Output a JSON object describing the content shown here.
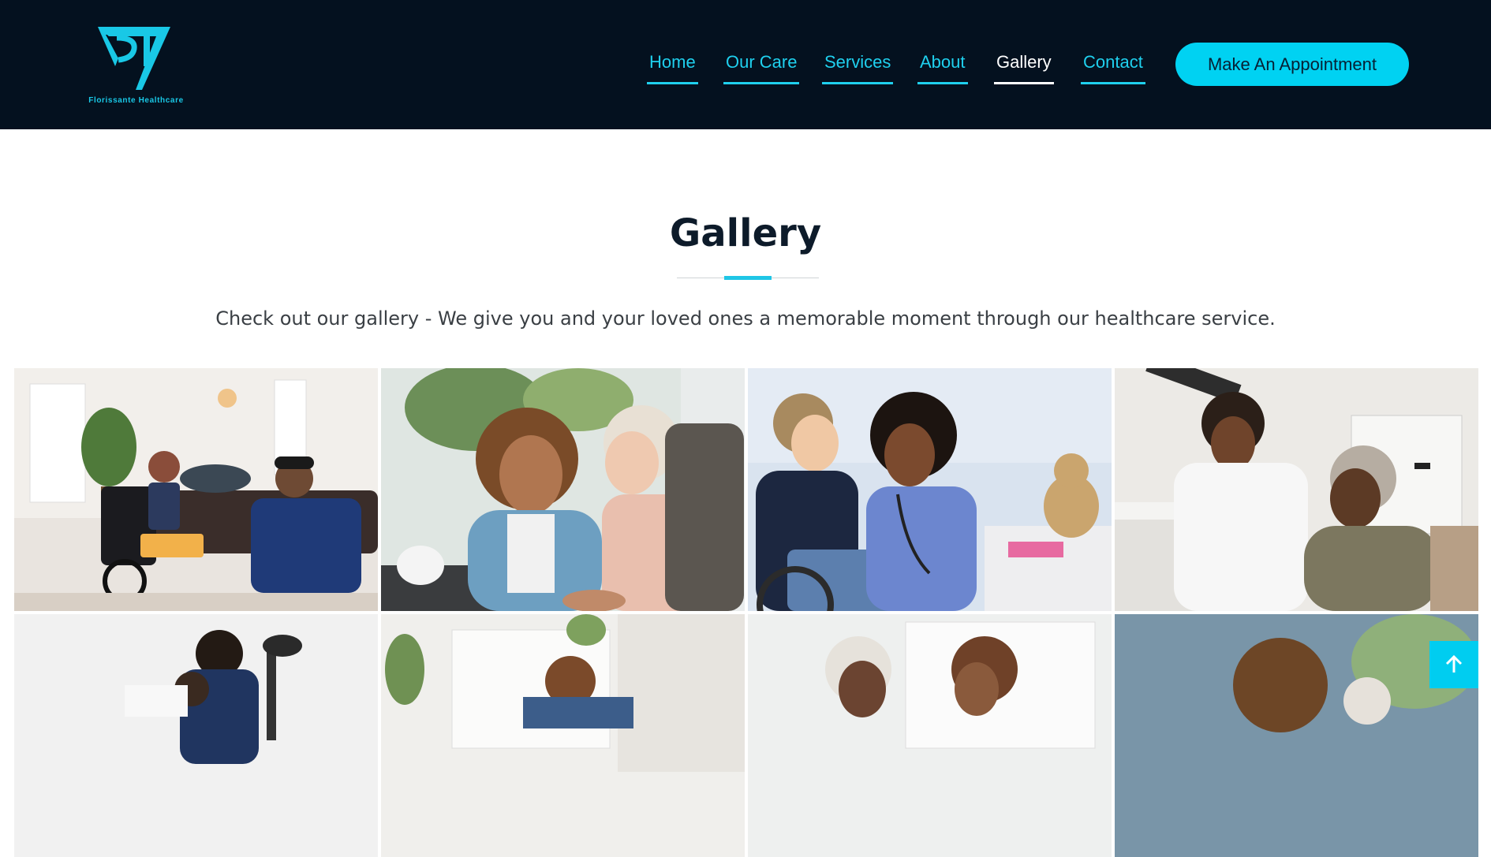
{
  "brand": {
    "name": "Florissante Healthcare",
    "accent_color": "#19c8e6",
    "header_bg": "#04111f"
  },
  "nav": {
    "items": [
      {
        "label": "Home",
        "active": false
      },
      {
        "label": "Our Care",
        "active": false
      },
      {
        "label": "Services",
        "active": false
      },
      {
        "label": "About",
        "active": false
      },
      {
        "label": "Gallery",
        "active": true
      },
      {
        "label": "Contact",
        "active": false
      }
    ],
    "cta_label": "Make An Appointment"
  },
  "gallery": {
    "title": "Gallery",
    "subtitle": "Check out our gallery - We give you and your loved ones a memorable moment through our healthcare service.",
    "photos": [
      {
        "icon": "photo-caregiver-child-wheelchair"
      },
      {
        "icon": "photo-caregiver-elderly-woman-smiling"
      },
      {
        "icon": "photo-nurse-boy-wheelchair"
      },
      {
        "icon": "photo-caregiver-elderly-woman-kitchen"
      },
      {
        "icon": "photo-caregiver-helping-patient"
      },
      {
        "icon": "photo-caregiver-living-room"
      },
      {
        "icon": "photo-elderly-woman-and-caregiver"
      },
      {
        "icon": "photo-caregiver-portrait"
      }
    ]
  },
  "scroll_top": {
    "icon": "arrow-up-icon"
  }
}
